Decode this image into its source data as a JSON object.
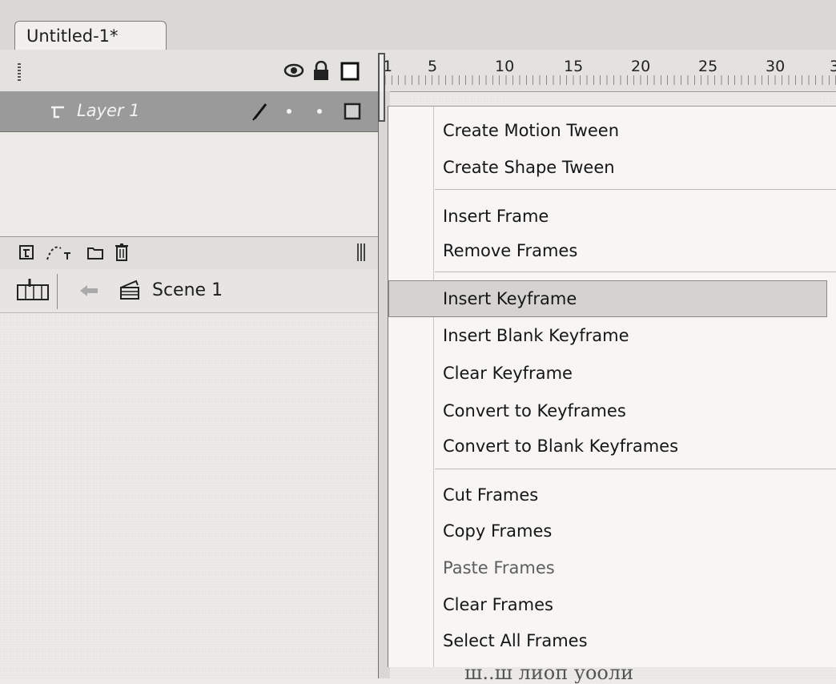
{
  "document_tab": {
    "title": "Untitled-1*"
  },
  "layers_header": {
    "icons": [
      "eye-icon",
      "lock-icon",
      "outline-square-icon"
    ]
  },
  "timeline": {
    "frame_numbers": [
      "1",
      "5",
      "10",
      "15",
      "20",
      "25",
      "30",
      "3"
    ]
  },
  "layers": [
    {
      "name": "Layer 1",
      "icons": [
        "layer-icon",
        "pencil-icon",
        "dot-icon",
        "dot-icon",
        "outline-square-icon"
      ]
    }
  ],
  "layer_toolbar": {
    "icons": [
      "new-layer-icon",
      "motion-guide-icon",
      "folder-icon",
      "trash-icon"
    ]
  },
  "scene_bar": {
    "scene_label": "Scene 1",
    "icons": [
      "timeline-icon",
      "back-arrow-icon",
      "clapper-icon"
    ]
  },
  "context_menu": {
    "items": [
      {
        "label": "Create Motion Tween"
      },
      {
        "label": "Create Shape Tween"
      },
      {
        "label": "Insert Frame"
      },
      {
        "label": "Remove Frames"
      },
      {
        "label": "Insert Keyframe"
      },
      {
        "label": "Insert Blank Keyframe"
      },
      {
        "label": "Clear Keyframe"
      },
      {
        "label": "Convert to Keyframes"
      },
      {
        "label": "Convert to Blank Keyframes"
      },
      {
        "label": "Cut Frames"
      },
      {
        "label": "Copy Frames"
      },
      {
        "label": "Paste Frames"
      },
      {
        "label": "Clear Frames"
      },
      {
        "label": "Select All Frames"
      }
    ],
    "highlighted_item": "Insert Keyframe",
    "disabled_item": "Paste Frames"
  },
  "colors": {
    "layer_row_selected": "#9a9a9a",
    "menu_background": "#f7f6f4",
    "menu_highlight": "#d4d3cf"
  },
  "scan_footer": {
    "text": "ш..ш лиоп уооли"
  }
}
